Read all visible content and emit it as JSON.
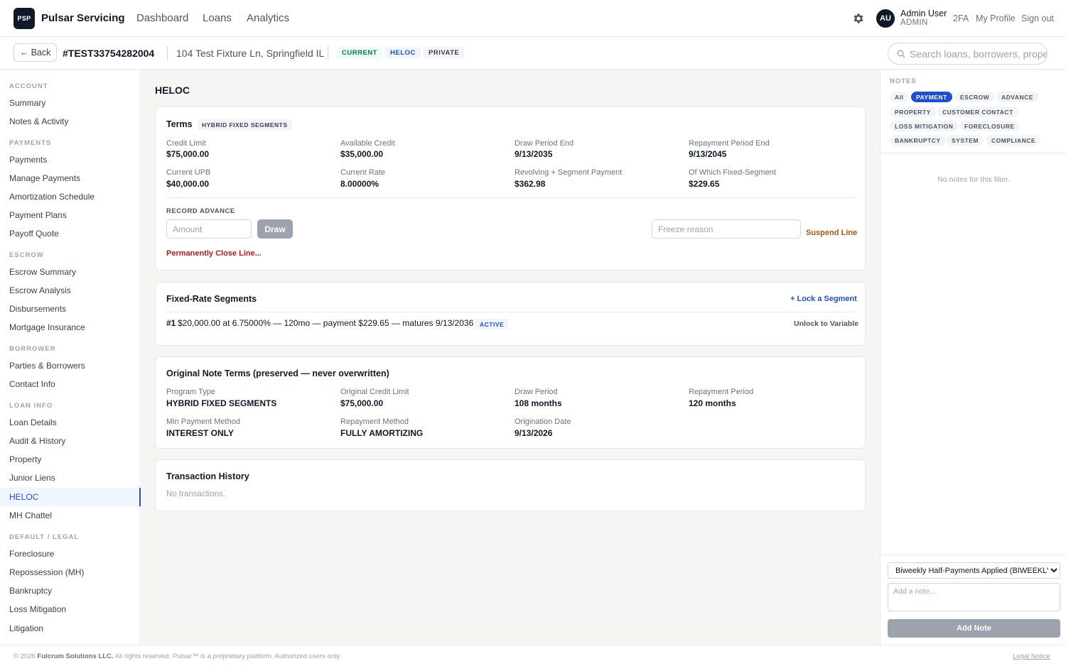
{
  "topnav": {
    "logo_text": "PSP",
    "brand": "Pulsar Servicing",
    "links": [
      "Dashboard",
      "Loans",
      "Analytics"
    ],
    "user_initials": "AU",
    "user_name": "Admin User",
    "user_role": "ADMIN",
    "right_links": [
      "2FA",
      "My Profile",
      "Sign out"
    ]
  },
  "subheader": {
    "back_label": "← Back",
    "loan_id": "#TEST33754282004",
    "address": "104 Test Fixture Ln, Springfield IL",
    "badges": [
      "CURRENT",
      "HELOC",
      "PRIVATE"
    ],
    "search_placeholder": "Search loans, borrowers, properties"
  },
  "sidebar": {
    "sections": [
      {
        "title": "ACCOUNT",
        "items": [
          "Summary",
          "Notes & Activity"
        ]
      },
      {
        "title": "PAYMENTS",
        "items": [
          "Payments",
          "Manage Payments",
          "Amortization Schedule",
          "Payment Plans",
          "Payoff Quote"
        ]
      },
      {
        "title": "ESCROW",
        "items": [
          "Escrow Summary",
          "Escrow Analysis",
          "Disbursements",
          "Mortgage Insurance"
        ]
      },
      {
        "title": "BORROWER",
        "items": [
          "Parties & Borrowers",
          "Contact Info"
        ]
      },
      {
        "title": "LOAN INFO",
        "items": [
          "Loan Details",
          "Audit & History",
          "Property",
          "Junior Liens",
          "HELOC",
          "MH Chattel"
        ]
      },
      {
        "title": "DEFAULT / LEGAL",
        "items": [
          "Foreclosure",
          "Repossession (MH)",
          "Bankruptcy",
          "Loss Mitigation",
          "Litigation"
        ]
      }
    ],
    "active": "HELOC"
  },
  "main": {
    "title": "HELOC",
    "terms": {
      "title": "Terms",
      "badge": "HYBRID FIXED SEGMENTS",
      "fields": [
        {
          "label": "Credit Limit",
          "value": "$75,000.00"
        },
        {
          "label": "Available Credit",
          "value": "$35,000.00"
        },
        {
          "label": "Draw Period End",
          "value": "9/13/2035"
        },
        {
          "label": "Repayment Period End",
          "value": "9/13/2045"
        },
        {
          "label": "Current UPB",
          "value": "$40,000.00"
        },
        {
          "label": "Current Rate",
          "value": "8.00000%"
        },
        {
          "label": "Revolving + Segment Payment",
          "value": "$362.98"
        },
        {
          "label": "Of Which Fixed-Segment",
          "value": "$229.65"
        }
      ],
      "record_advance_label": "RECORD ADVANCE",
      "amount_placeholder": "Amount",
      "draw_label": "Draw",
      "freeze_placeholder": "Freeze reason",
      "suspend_label": "Suspend Line",
      "close_label": "Permanently Close Line..."
    },
    "segments": {
      "title": "Fixed-Rate Segments",
      "lock_label": "+ Lock a Segment",
      "rows": [
        {
          "num": "#1",
          "text": "$20,000.00 at 6.75000% — 120mo — payment $229.65 — matures 9/13/2036",
          "status": "ACTIVE",
          "action": "Unlock to Variable"
        }
      ]
    },
    "original": {
      "title": "Original Note Terms (preserved — never overwritten)",
      "fields": [
        {
          "label": "Program Type",
          "value": "HYBRID FIXED SEGMENTS"
        },
        {
          "label": "Original Credit Limit",
          "value": "$75,000.00"
        },
        {
          "label": "Draw Period",
          "value": "108 months"
        },
        {
          "label": "Repayment Period",
          "value": "120 months"
        },
        {
          "label": "Min Payment Method",
          "value": "INTEREST ONLY"
        },
        {
          "label": "Repayment Method",
          "value": "FULLY AMORTIZING"
        },
        {
          "label": "Origination Date",
          "value": "9/13/2026"
        }
      ]
    },
    "transactions": {
      "title": "Transaction History",
      "empty": "No transactions."
    }
  },
  "notes": {
    "label": "NOTES",
    "chips": [
      "All",
      "PAYMENT",
      "ESCROW",
      "ADVANCE",
      "PROPERTY",
      "CUSTOMER CONTACT",
      "LOSS MITIGATION",
      "FORECLOSURE",
      "BANKRUPTCY",
      "SYSTEM",
      "COMPLIANCE"
    ],
    "active_chip": "PAYMENT",
    "empty": "No notes for this filter.",
    "template_selected": "Biweekly Half-Payments Applied (BIWEEKLY)",
    "note_placeholder": "Add a note...",
    "add_label": "Add Note"
  },
  "footer": {
    "copyright_prefix": "© 2026",
    "company": "Fulcrum Solutions LLC.",
    "copyright_suffix": "All rights reserved. Pulsar™ is a proprietary platform. Authorized users only.",
    "legal": "Legal Notice"
  },
  "colors": {
    "accent": "#1d4ed8",
    "danger": "#b91c1c",
    "warning": "#b45309",
    "success": "#047857"
  }
}
